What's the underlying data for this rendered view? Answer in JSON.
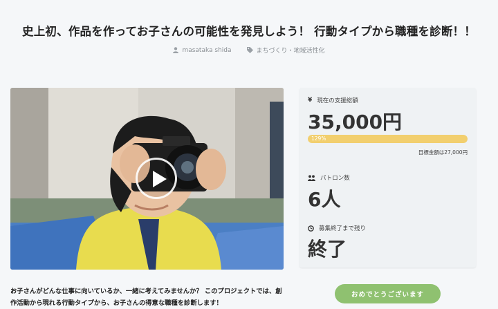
{
  "header": {
    "title": "史上初、作品を作ってお子さんの可能性を発見しよう！ 行動タイプから職種を診断！！",
    "author": "masataka shida",
    "category": "まちづくり・地域活性化"
  },
  "video": {
    "play_icon": "play-icon"
  },
  "stats": {
    "raised_label": "現在の支援総額",
    "raised_value": "35,000円",
    "progress_text": "129%",
    "progress_percent": 129,
    "goal_text": "目標金額は27,000円",
    "patrons_label": "パトロン数",
    "patrons_value": "6人",
    "remaining_label": "募集終了まで残り",
    "remaining_value": "終了"
  },
  "description": "お子さんがどんな仕事に向いているか、一緒に考えてみませんか？ このプロジェクトでは、創作活動から現れる行動タイプから、お子さんの得意な職種を診断します！",
  "cta": {
    "label": "おめでとうございます"
  },
  "colors": {
    "progress": "#f2cf6e",
    "cta": "#8fc170",
    "background": "#f5f7f9"
  }
}
